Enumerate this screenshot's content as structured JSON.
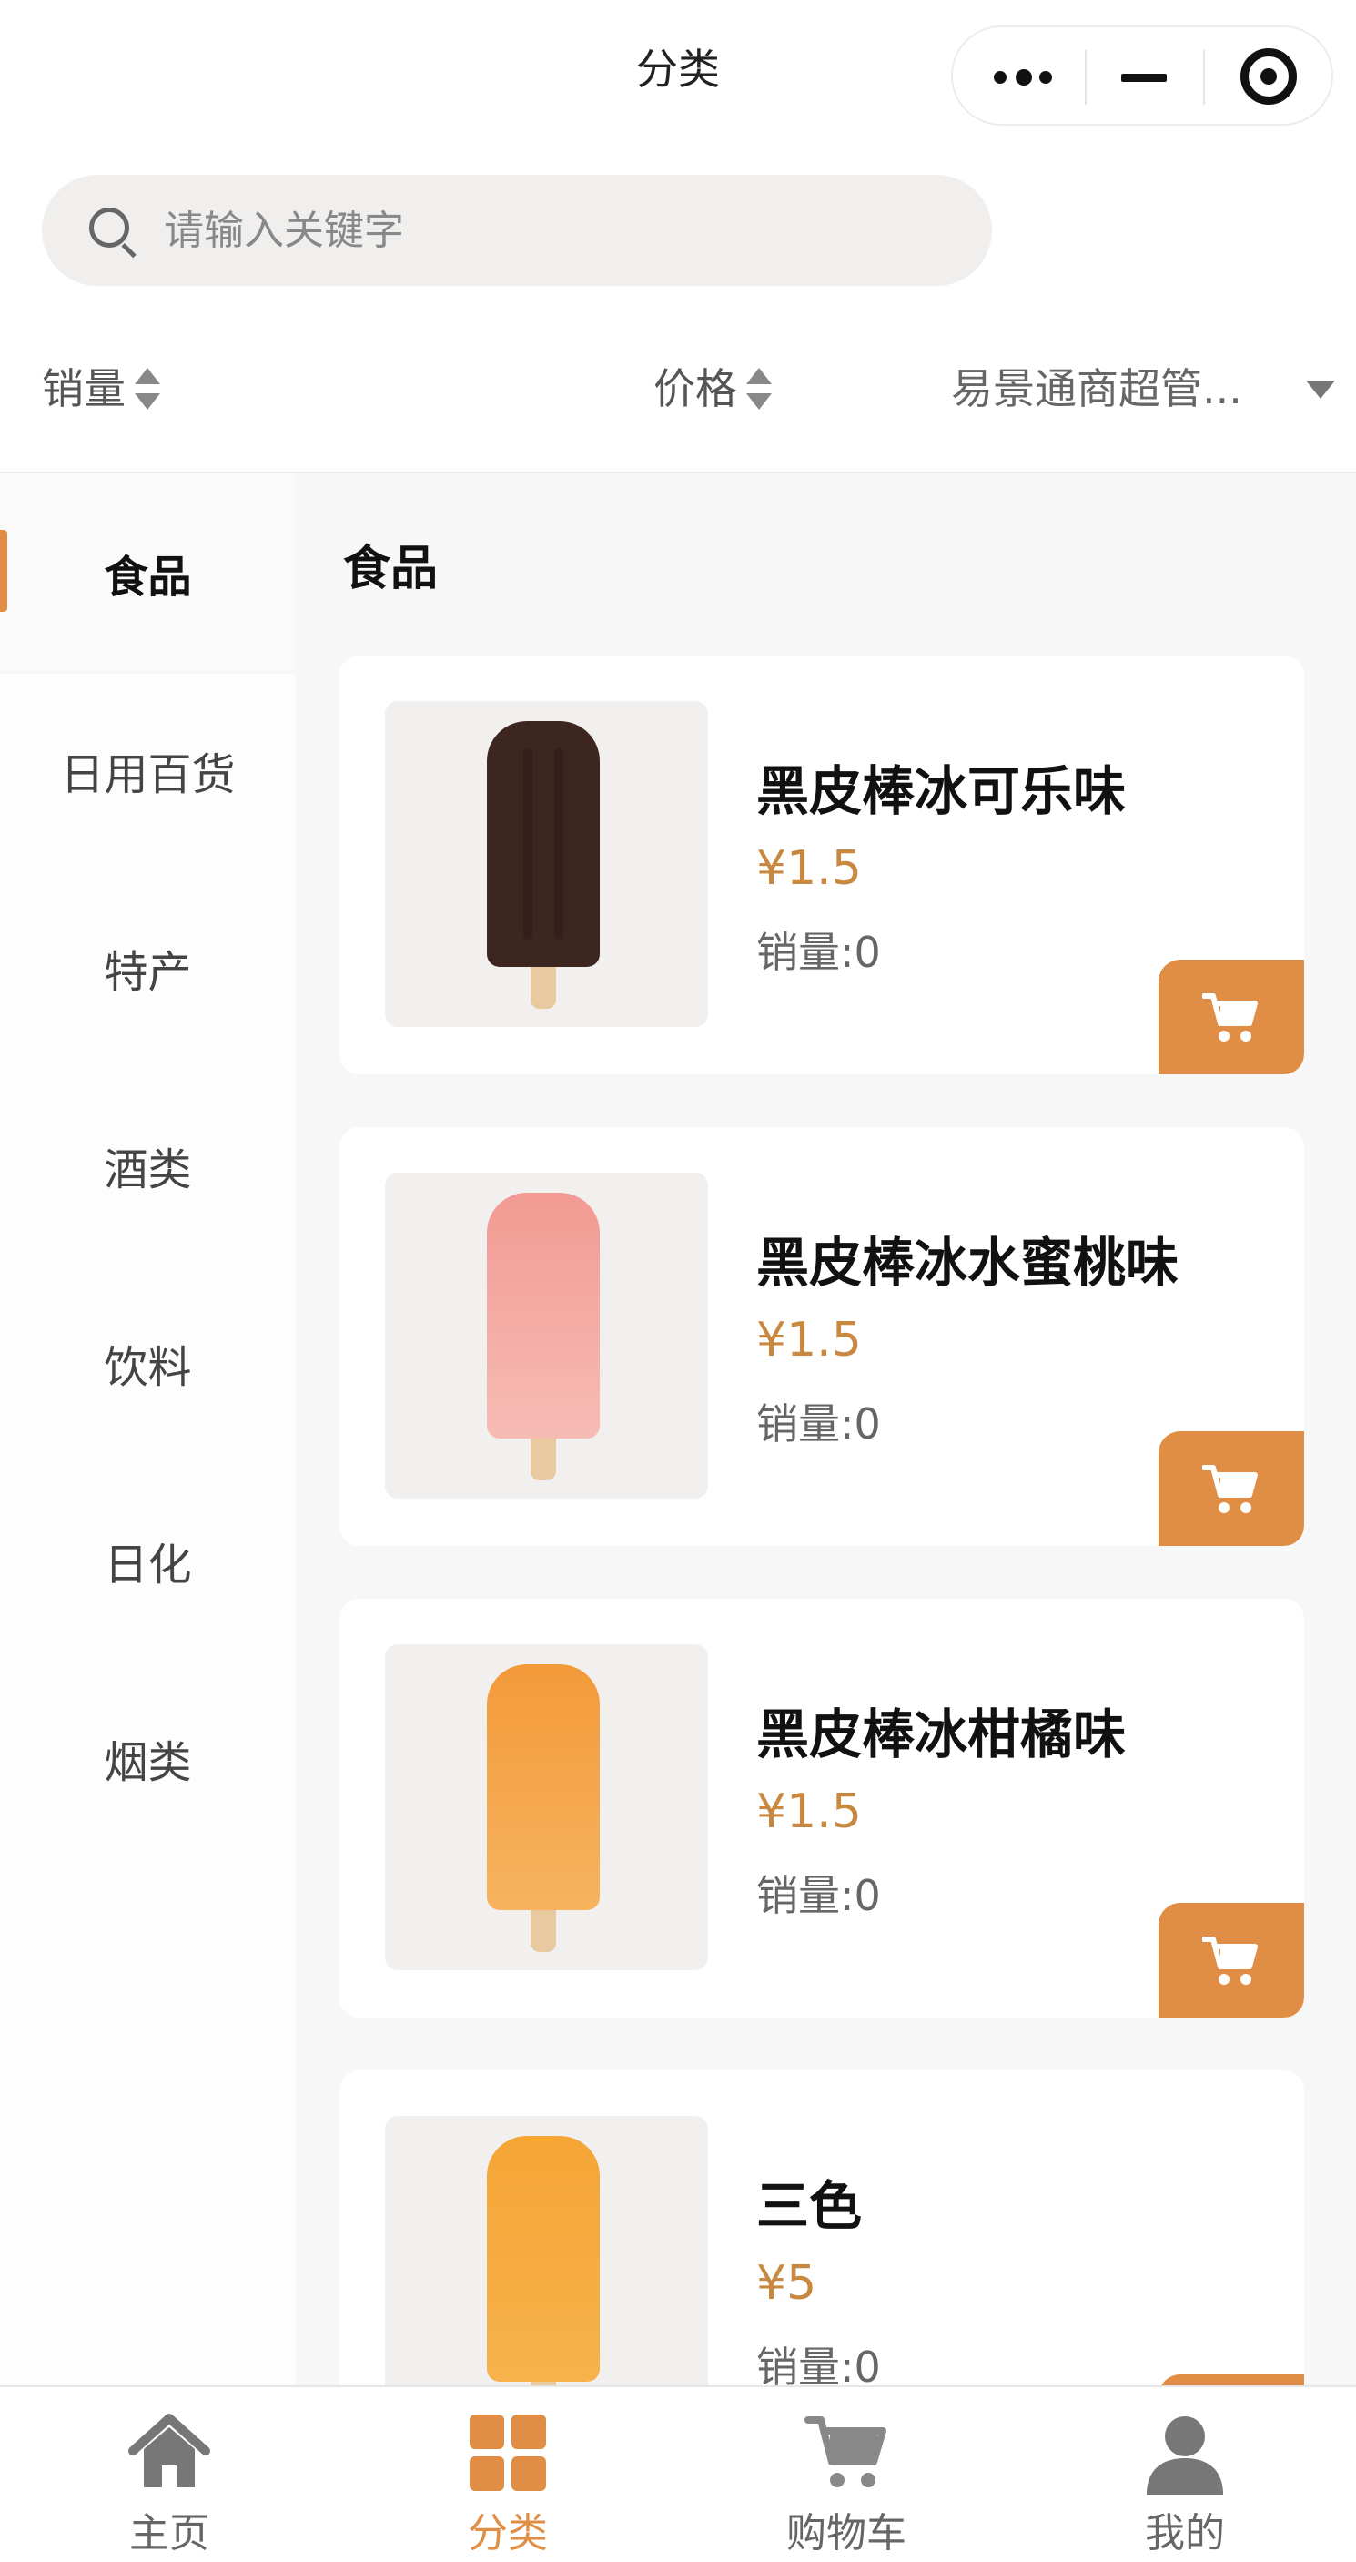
{
  "header": {
    "title": "分类"
  },
  "search": {
    "placeholder": "请输入关键字",
    "value": ""
  },
  "sortbar": {
    "sales_label": "销量",
    "price_label": "价格",
    "store_label": "易景通商超管..."
  },
  "sidebar": {
    "items": [
      {
        "label": "食品",
        "active": true
      },
      {
        "label": "日用百货"
      },
      {
        "label": "特产"
      },
      {
        "label": "酒类"
      },
      {
        "label": "饮料"
      },
      {
        "label": "日化"
      },
      {
        "label": "烟类"
      }
    ]
  },
  "main": {
    "category_title": "食品",
    "products": [
      {
        "name": "黑皮棒冰可乐味",
        "price": "¥1.5",
        "sales": "销量:0",
        "color": "#3d2520"
      },
      {
        "name": "黑皮棒冰水蜜桃味",
        "price": "¥1.5",
        "sales": "销量:0",
        "color": "#f2a29a"
      },
      {
        "name": "黑皮棒冰柑橘味",
        "price": "¥1.5",
        "sales": "销量:0",
        "color": "#f4a34a"
      },
      {
        "name": "三色",
        "price": "¥5",
        "sales": "销量:0",
        "color": "#f5a83d"
      }
    ]
  },
  "tabbar": {
    "items": [
      {
        "label": "主页",
        "icon": "home-icon"
      },
      {
        "label": "分类",
        "icon": "category-icon",
        "active": true
      },
      {
        "label": "购物车",
        "icon": "cart-icon"
      },
      {
        "label": "我的",
        "icon": "user-icon"
      }
    ]
  },
  "colors": {
    "accent": "#e08e45",
    "price": "#c8883f"
  }
}
